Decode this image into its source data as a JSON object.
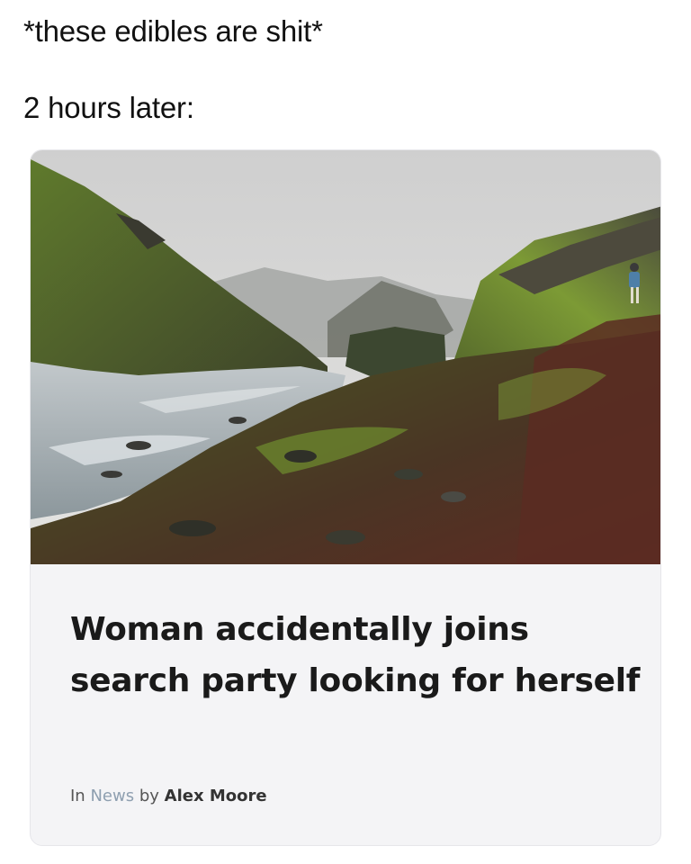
{
  "caption": {
    "line1": "*these edibles are shit*",
    "line2": "2 hours later:"
  },
  "article": {
    "headline": "Woman accidentally joins search party looking for herself",
    "byline_prefix": "In",
    "category": "News",
    "byline_by": "by",
    "author": "Alex Moore"
  },
  "colors": {
    "sky": "#d9d9d9",
    "moss_green": "#6f8f2f",
    "river": "#a9b4ba",
    "dirt_path": "#6b2e24",
    "category_link": "#8e9fb0"
  }
}
